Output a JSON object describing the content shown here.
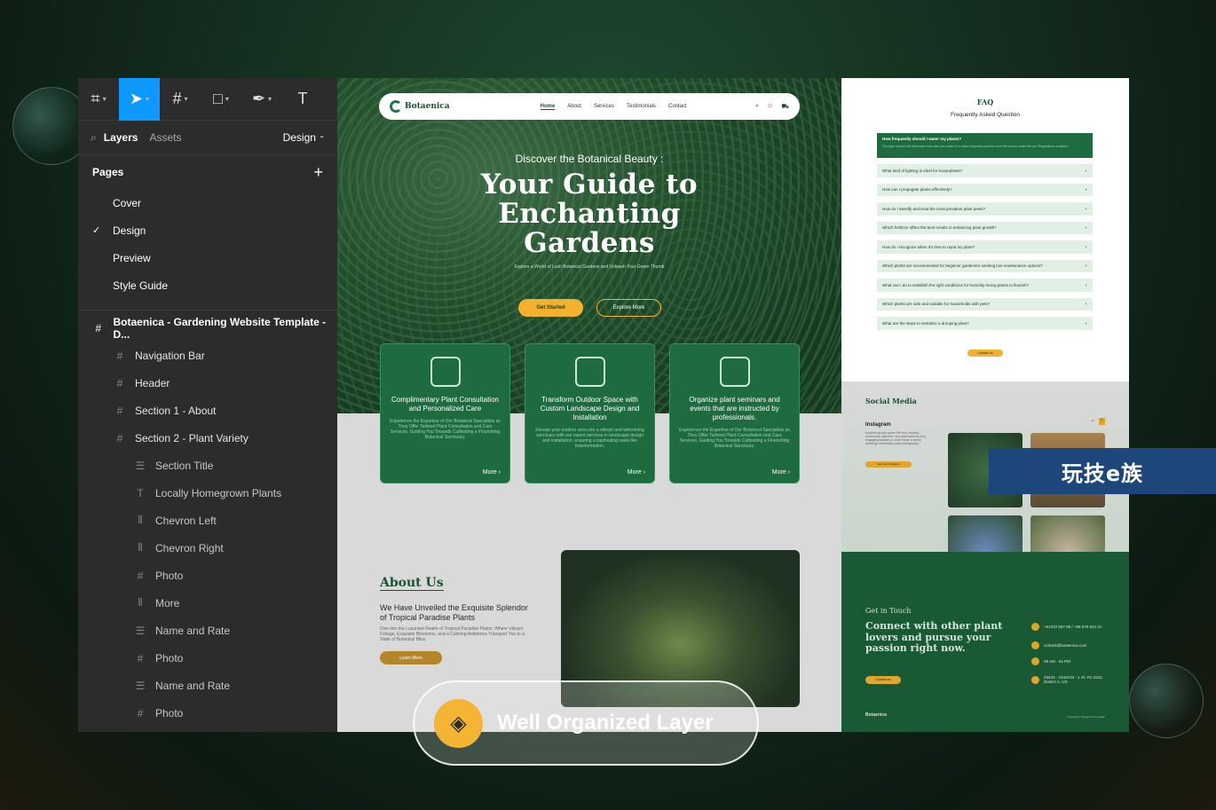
{
  "figma": {
    "tabs": {
      "layers": "Layers",
      "assets": "Assets",
      "mode": "Design"
    },
    "pages_title": "Pages",
    "pages": [
      {
        "label": "Cover",
        "checked": false
      },
      {
        "label": "Design",
        "checked": true
      },
      {
        "label": "Preview",
        "checked": false
      },
      {
        "label": "Style Guide",
        "checked": false
      }
    ],
    "frame": "Botaenica - Gardening Website Template - D...",
    "layers": [
      {
        "label": "Navigation Bar",
        "icon": "#",
        "indent": 1
      },
      {
        "label": "Header",
        "icon": "#",
        "indent": 1
      },
      {
        "label": "Section 1 - About",
        "icon": "#",
        "indent": 1
      },
      {
        "label": "Section 2 - Plant Variety",
        "icon": "#",
        "indent": 1
      },
      {
        "label": "Section Title",
        "icon": "☰",
        "indent": 2
      },
      {
        "label": "Locally Homegrown Plants",
        "icon": "T",
        "indent": 2
      },
      {
        "label": "Chevron Left",
        "icon": "⫴",
        "indent": 2
      },
      {
        "label": "Chevron Right",
        "icon": "⫴",
        "indent": 2
      },
      {
        "label": "Photo",
        "icon": "#",
        "indent": 2
      },
      {
        "label": "More",
        "icon": "⫴",
        "indent": 2
      },
      {
        "label": "Name and Rate",
        "icon": "☰",
        "indent": 2
      },
      {
        "label": "Photo",
        "icon": "#",
        "indent": 2
      },
      {
        "label": "Name and Rate",
        "icon": "☰",
        "indent": 2
      },
      {
        "label": "Photo",
        "icon": "#",
        "indent": 2
      }
    ]
  },
  "site": {
    "logo": "Botaenica",
    "nav": [
      "Home",
      "About",
      "Services",
      "Testimonials",
      "Contact"
    ],
    "hero": {
      "eyebrow": "Discover the Botanical Beauty :",
      "title_lines": [
        "Your Guide to",
        "Enchanting",
        "Gardens"
      ],
      "sub": "Explore a World of Lush Botanical Gardens and Unleash Your Green Thumb",
      "btn_primary": "Get Started",
      "btn_secondary": "Explore More"
    },
    "cards": [
      {
        "title": "Complimentary Plant Consultation and Personalized Care",
        "desc": "Experience the Expertise of Our Botanical Specialists as They Offer Tailored Plant Consultation and Care Services, Guiding You Towards Cultivating a Flourishing Botanical Sanctuary.",
        "more": "More"
      },
      {
        "title": "Transform Outdoor Space with Custom Landscape Design and Installation",
        "desc": "Elevate your outdoor area into a vibrant and welcoming sanctuary with our expert services in landscape design and installation, ensuring a captivating oasis like transformation.",
        "more": "More"
      },
      {
        "title": "Organize plant seminars and events that are instructed by professionals.",
        "desc": "Experience the Expertise of Our Botanical Specialists as They Offer Tailored Plant Consultation and Care Services, Guiding You Towards Cultivating a Flourishing Botanical Sanctuary.",
        "more": "More"
      }
    ],
    "about": {
      "title": "About Us",
      "heading": "We Have Unveiled the Exquisite Splendor of Tropical Paradise Plants",
      "desc": "Dive into the Luxuriant Realm of Tropical Paradise Plants, Where Vibrant Foliage, Exquisite Blossoms, and a Calming Ambience Transport You to a State of Botanical Bliss.",
      "btn": "Learn More"
    }
  },
  "faq": {
    "title": "FAQ",
    "subtitle": "Frequently Asked Question",
    "active": {
      "q": "How frequently should I water my plants?",
      "a": "The type of plant will determine how often you water it. In other frequency and the more the humid, water the pot. Regulations available..."
    },
    "items": [
      "What kind of lighting is ideal for houseplants?",
      "How can I propagate plants effectively?",
      "How do I identify and treat the most prevalent plant pests?",
      "Which fertilizer offers the best results in enhancing plant growth?",
      "How do I recognize when it's time to repot my plant?",
      "Which plants are recommended for beginner gardeners seeking low-maintenance options?",
      "What can I do to establish the right conditions for humidity-loving plants to flourish?",
      "Which plants are safe and suitable for households with pets?",
      "What are the steps to revitalize a drooping plant?"
    ],
    "contact_btn": "Contact Us",
    "social": {
      "title": "Social Media",
      "ig": "Instagram",
      "ig_desc": "Nourishing your green life from thriving community, discover new plant species plus engaging updates & more share a lovely amazing community plant photography",
      "ig_btn": "See Our Instagram"
    },
    "touch": {
      "label": "Get in Touch",
      "heading": "Connect with other plant lovers and pursue your passion right now.",
      "btn": "Contact us",
      "phone": "+51234 567 89 / +99 876 543 21",
      "email": "contact@botaenica.com",
      "hours": "08 AM - 04 PM",
      "address": "23423 - 23423 M - 1 St. FU 2342 District A, US",
      "footer_logo": "Botaenica",
      "copyright": "Copyright © Botaenica Template"
    }
  },
  "watermark": "玩技e族",
  "badge": {
    "label": "Well Organized Layer",
    "icon": "layers-icon"
  },
  "colors": {
    "brand_green": "#1e6b3f",
    "accent": "#f2b230",
    "figma_select": "#0d99ff"
  }
}
